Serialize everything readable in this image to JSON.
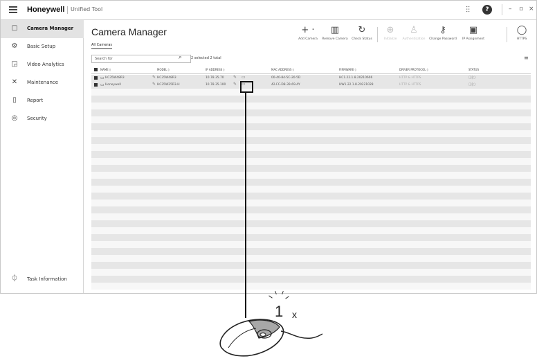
{
  "app": {
    "brand": "Honeywell",
    "subtitle": "Unified Tool",
    "window_controls": [
      "–",
      "▫",
      "×"
    ]
  },
  "sidebar": {
    "items": [
      {
        "label": "Camera Manager",
        "icon": "camera-icon",
        "active": true
      },
      {
        "label": "Basic Setup",
        "icon": "gear-icon",
        "active": false
      },
      {
        "label": "Video Analytics",
        "icon": "analytics-icon",
        "active": false
      },
      {
        "label": "Maintenance",
        "icon": "wrench-icon",
        "active": false
      },
      {
        "label": "Report",
        "icon": "report-icon",
        "active": false
      },
      {
        "label": "Security",
        "icon": "shield-icon",
        "active": false
      }
    ],
    "footer": {
      "label": "Task Information",
      "icon": "task-icon"
    }
  },
  "main": {
    "title": "Camera Manager",
    "toolbar": [
      {
        "label": "Add Camera",
        "icon": "plus-icon",
        "enabled": true
      },
      {
        "label": "Remove Camera",
        "icon": "trash-icon",
        "enabled": true
      },
      {
        "label": "Check Status",
        "icon": "refresh-icon",
        "enabled": true
      },
      {
        "label": "Initialize",
        "icon": "initialize-icon",
        "enabled": false
      },
      {
        "label": "Authentication",
        "icon": "user-icon",
        "enabled": false
      },
      {
        "label": "Change Password",
        "icon": "key-icon",
        "enabled": true
      },
      {
        "label": "IP Assignment",
        "icon": "ip-icon",
        "enabled": true
      },
      {
        "label": "HTTPS",
        "icon": "lock-icon",
        "enabled": true
      }
    ],
    "tab": "All Cameras",
    "search": {
      "placeholder": "Search for"
    },
    "selection_count": "2 selected 2 total",
    "table": {
      "columns": [
        "NAME ◊",
        "MODEL ◊",
        "IP ADDRESS ◊",
        "MAC ADDRESS ◊",
        "FIRMWARE ◊",
        "DRIVER PROTOCOL ◊",
        "STATUS"
      ],
      "rows": [
        {
          "name": "HC35W48R3",
          "model": "HC35W48R3",
          "ip": "10.78.35.70",
          "mac": "00-40-84-5C-20-5D",
          "firmware": "HC1.22.1.8.20210606",
          "protocol": "HTTP & HTTPS"
        },
        {
          "name": "Honeywell",
          "model": "HC35W25R3-H",
          "ip": "10.78.35.100",
          "mac": "42-FC-D8-39-69-AY",
          "firmware": "HW1.22.1.8.20221028",
          "protocol": "HTTP & HTTPS"
        }
      ]
    }
  },
  "callout": {
    "clicks": "1",
    "multiplier": "x"
  }
}
